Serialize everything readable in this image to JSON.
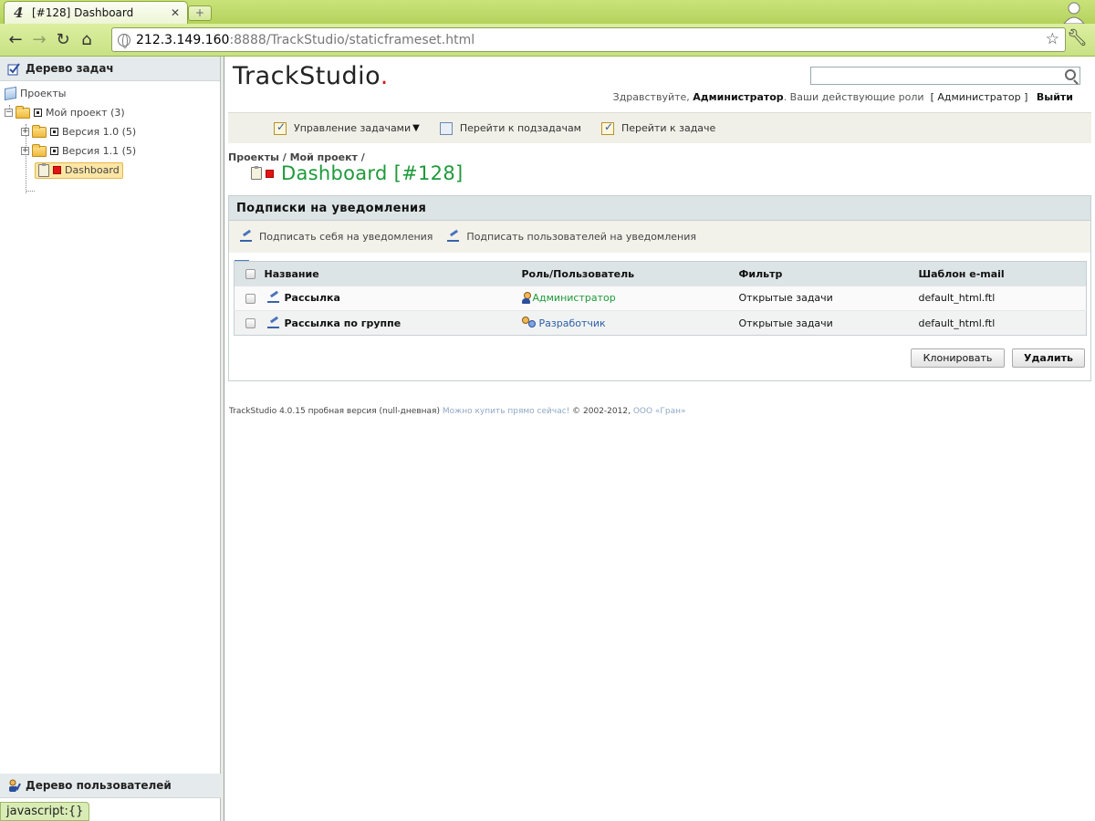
{
  "browser": {
    "tab_title": "[#128] Dashboard",
    "tab_logo": "4",
    "url_host": "212.3.149.160",
    "url_rest": ":8888/TrackStudio/staticframeset.html",
    "status_text": "javascript:{}"
  },
  "left": {
    "tasks_header": "Дерево задач",
    "tree": {
      "root": "Проекты",
      "project": "Мой проект (3)",
      "version1": "Версия 1.0 (5)",
      "version2": "Версия 1.1 (5)",
      "selected": "Dashboard"
    },
    "users_header": "Дерево пользователей"
  },
  "main": {
    "logo_text": "TrackStudio",
    "logo_dot": ".",
    "greeting": {
      "hello": "Здравствуйте,",
      "user": "Администратор",
      "roles_text": ". Ваши действующие роли",
      "role": "[ Администратор ]",
      "logout": "Выйти"
    },
    "actions": {
      "manage": "Управление задачами",
      "subtasks": "Перейти к подзадачам",
      "goto": "Перейти к задаче"
    },
    "breadcrumb": "Проекты / Мой проект /",
    "task_title": "Dashboard  [#128]",
    "panel": {
      "title": "Подписки на уведомления",
      "subscribe_self": "Подписать себя на уведомления",
      "subscribe_users": "Подписать пользователей на уведомления",
      "columns": [
        "Название",
        "Роль/Пользователь",
        "Фильтр",
        "Шаблон e-mail"
      ],
      "rows": [
        {
          "name": "Рассылка",
          "user": "Администратор",
          "filter": "Открытые задачи",
          "template": "default_html.ftl"
        },
        {
          "name": "Рассылка по группе",
          "user": "Разработчик",
          "filter": "Открытые задачи",
          "template": "default_html.ftl"
        }
      ],
      "clone_button": "Клонировать",
      "delete_button": "Удалить"
    },
    "footer": {
      "version": "TrackStudio 4.0.15 пробная версия (null-дневная)",
      "buy_link": "Можно купить прямо сейчас!",
      "copyright": "© 2002-2012,",
      "company_link": "ООО «Гран»"
    }
  },
  "colors": {
    "chrome_green": "#c8e184",
    "title_green": "#1e9a3a",
    "link_blue": "#2a5fa8",
    "header_gray": "#dde4e6"
  }
}
